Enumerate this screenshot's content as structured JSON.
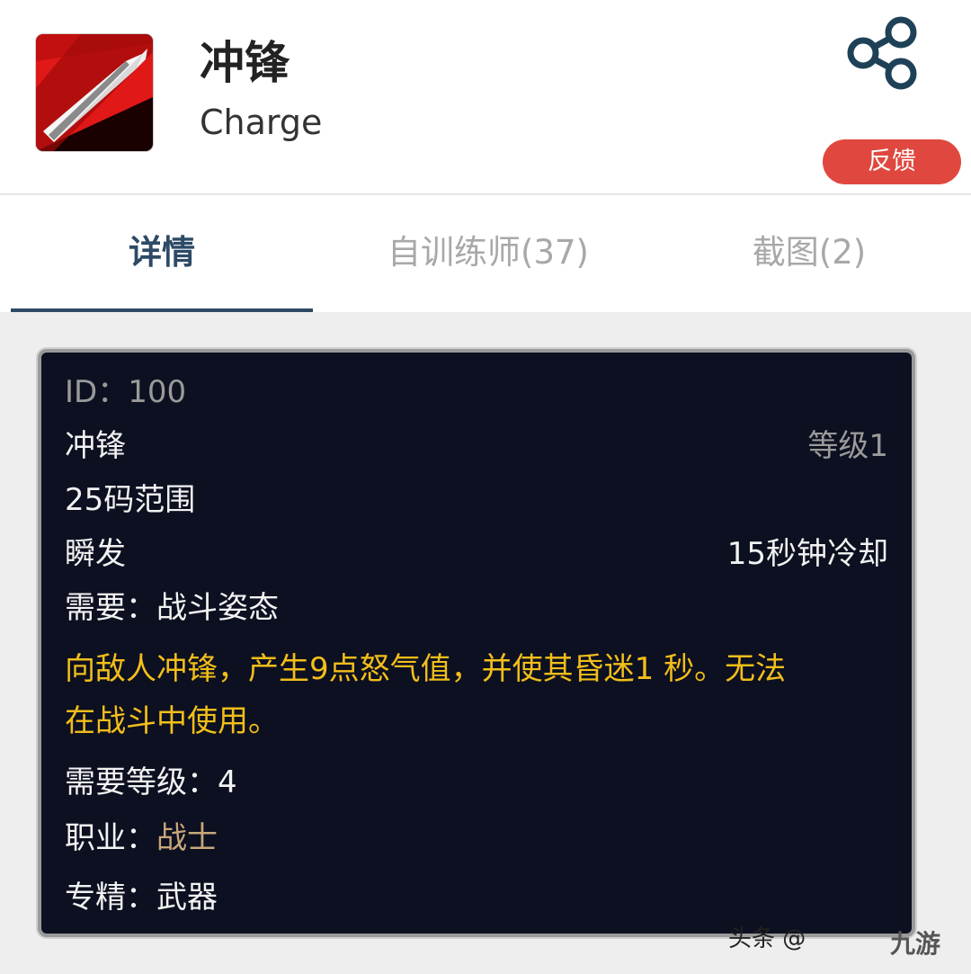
{
  "header": {
    "icon": "charge-skill-icon",
    "title": "冲锋",
    "subtitle": "Charge",
    "share_icon": "share-icon",
    "feedback_label": "反馈"
  },
  "tabs": [
    {
      "label": "详情",
      "active": true
    },
    {
      "label": "自训练师(37)",
      "active": false
    },
    {
      "label": "截图(2)",
      "active": false
    }
  ],
  "tooltip": {
    "id_label": "ID：",
    "id_value": "100",
    "name": "冲锋",
    "rank": "等级1",
    "range": "25码范围",
    "cast_time": "瞬发",
    "cooldown": "15秒钟冷却",
    "requires_label": "需要：",
    "requires_value": "战斗姿态",
    "description_line1": "向敌人冲锋，产生9点怒气值，并使其昏迷1 秒。无法",
    "description_line2": "在战斗中使用。",
    "req_level_label": "需要等级：",
    "req_level_value": "4",
    "class_label": "职业：",
    "class_value": "战士",
    "spec_label": "专精：",
    "spec_value": "武器"
  },
  "watermark": {
    "text": "头条 @",
    "logo": "九游"
  },
  "colors": {
    "feedback_button": "#e0483f",
    "active_tab": "#2d4a66",
    "tooltip_bg": "#0c1020",
    "description_gold": "#f2be1a",
    "class_tan": "#c8a67a"
  }
}
